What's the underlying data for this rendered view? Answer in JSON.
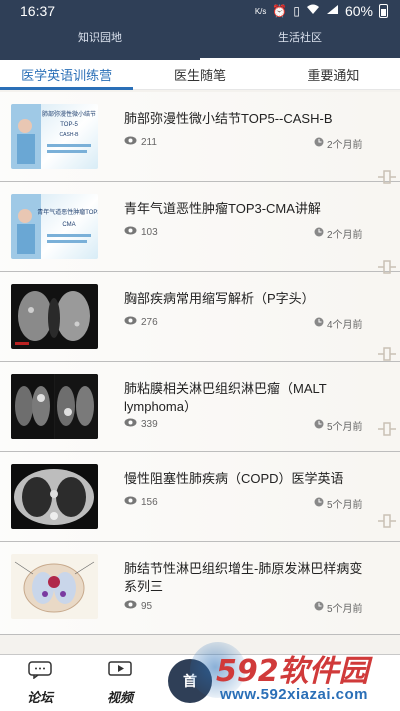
{
  "status_bar": {
    "time": "16:37",
    "battery": "60%",
    "network_label": "K/s"
  },
  "top_tabs": [
    {
      "label": "知识园地",
      "active": false
    },
    {
      "label": "生活社区",
      "active": true
    }
  ],
  "sub_tabs": [
    {
      "label": "医学英语训练营",
      "active": true
    },
    {
      "label": "医生随笔",
      "active": false
    },
    {
      "label": "重要通知",
      "active": false
    }
  ],
  "articles": [
    {
      "title": "肺部弥漫性微小结节TOP5--CASH-B",
      "views": "211",
      "time": "2个月前",
      "thumb_text": [
        "肺部弥漫性微小结节",
        "TOP-5",
        "CASH-B"
      ]
    },
    {
      "title": "青年气道恶性肿瘤TOP3-CMA讲解",
      "views": "103",
      "time": "2个月前",
      "thumb_text": [
        "青年气道恶性肿瘤TOP3",
        "CMA"
      ]
    },
    {
      "title": "胸部疾病常用缩写解析（P字头）",
      "views": "276",
      "time": "4个月前"
    },
    {
      "title": "肺粘膜相关淋巴组织淋巴瘤（MALT lymphoma）",
      "views": "339",
      "time": "5个月前"
    },
    {
      "title": "慢性阻塞性肺疾病（COPD）医学英语",
      "views": "156",
      "time": "5个月前"
    },
    {
      "title": "肺结节性淋巴组织增生-肺原发淋巴样病变系列三",
      "views": "95",
      "time": "5个月前"
    }
  ],
  "bottom_nav": {
    "forum": "论坛",
    "video": "视频",
    "home": "首"
  },
  "watermark": {
    "logo": "592软件园",
    "url": "www.592xiazai.com"
  },
  "colors": {
    "header_bg": "#2f3f57",
    "accent": "#2a6fb7"
  }
}
